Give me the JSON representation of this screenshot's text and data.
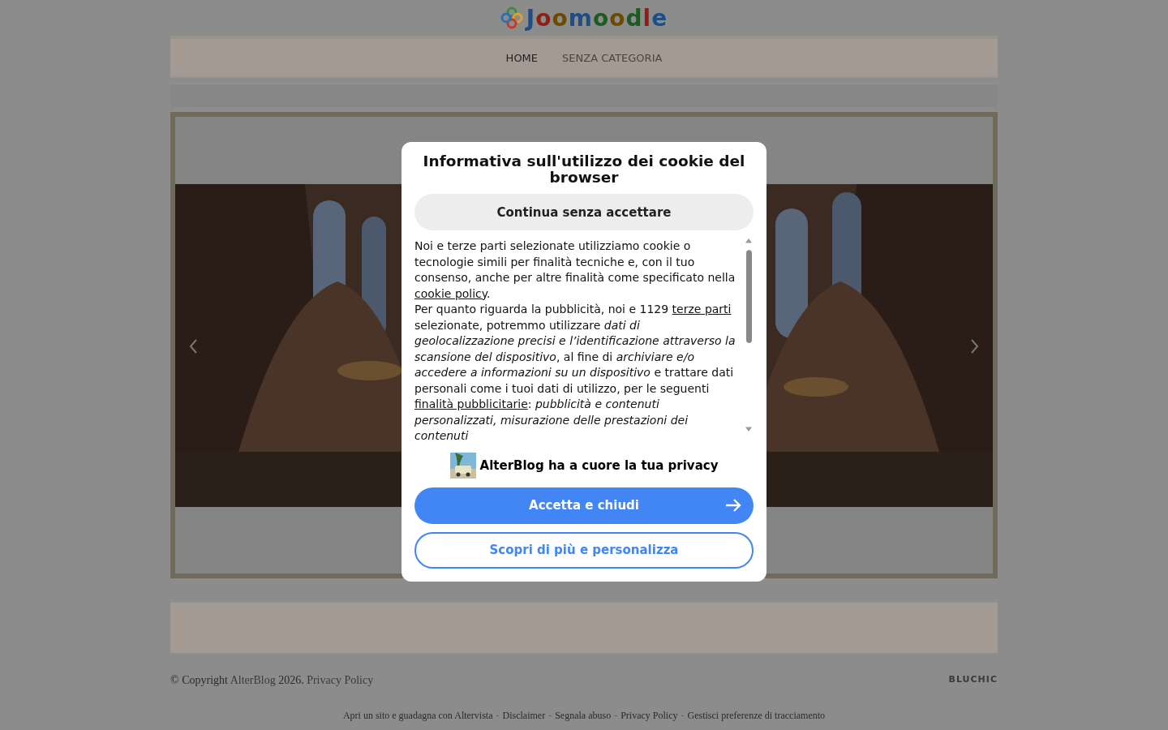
{
  "header": {
    "logo": "Joomoodle"
  },
  "nav": {
    "items": [
      {
        "label": "HOME",
        "selected": true
      },
      {
        "label": "SENZA CATEGORIA",
        "selected": false
      }
    ]
  },
  "cookie_dialog": {
    "title": "Informativa sull'utilizzo dei cookie del browser",
    "continue_button": "Continua senza accettare",
    "body": [
      {
        "kind": "text",
        "text": "Noi e terze parti selezionate utilizziamo cookie o tecnologie simili per finalità tecniche e, con il tuo consenso, anche per altre finalità come specificato nella "
      },
      {
        "kind": "link",
        "text": "cookie policy"
      },
      {
        "kind": "text",
        "text": "."
      },
      {
        "kind": "break"
      },
      {
        "kind": "text",
        "text": "Per quanto riguarda la pubblicità, noi e 1129 "
      },
      {
        "kind": "link",
        "text": "terze parti"
      },
      {
        "kind": "text",
        "text": " selezionate, potremmo utilizzare "
      },
      {
        "kind": "italic",
        "text": "dati di geolocalizzazione precisi e l’identificazione attraverso la scansione del dispositivo"
      },
      {
        "kind": "text",
        "text": ", al fine di "
      },
      {
        "kind": "italic",
        "text": "archiviare e/o accedere a informazioni su un dispositivo"
      },
      {
        "kind": "text",
        "text": " e trattare dati personali come i tuoi dati di utilizzo, per le seguenti "
      },
      {
        "kind": "link",
        "text": "finalità pubblicitarie"
      },
      {
        "kind": "text",
        "text": ": "
      },
      {
        "kind": "italic",
        "text": "pubblicità e contenuti personalizzati, misurazione delle prestazioni dei contenuti"
      }
    ],
    "brand_line": "AlterBlog ha a cuore la tua privacy",
    "accept_button": "Accetta e chiudi",
    "customize_button": "Scopri di più e personalizza"
  },
  "footer": {
    "copyright": [
      {
        "kind": "text",
        "text": "© Copyright "
      },
      {
        "kind": "link",
        "text": "AlterBlog"
      },
      {
        "kind": "text",
        "text": " 2026. "
      },
      {
        "kind": "link",
        "text": "Privacy Policy"
      }
    ],
    "credit": "BLUCHIC",
    "links": [
      {
        "kind": "link",
        "text": "Apri un sito e guadagna con Altervista"
      },
      {
        "kind": "separator",
        "text": "-"
      },
      {
        "kind": "link",
        "text": "Disclaimer"
      },
      {
        "kind": "separator",
        "text": "-"
      },
      {
        "kind": "link",
        "text": "Segnala abuso"
      },
      {
        "kind": "separator",
        "text": "-"
      },
      {
        "kind": "link",
        "text": "Privacy Policy"
      },
      {
        "kind": "separator",
        "text": "-"
      },
      {
        "kind": "link",
        "text": "Gestisci preferenze di tracciamento"
      }
    ]
  }
}
